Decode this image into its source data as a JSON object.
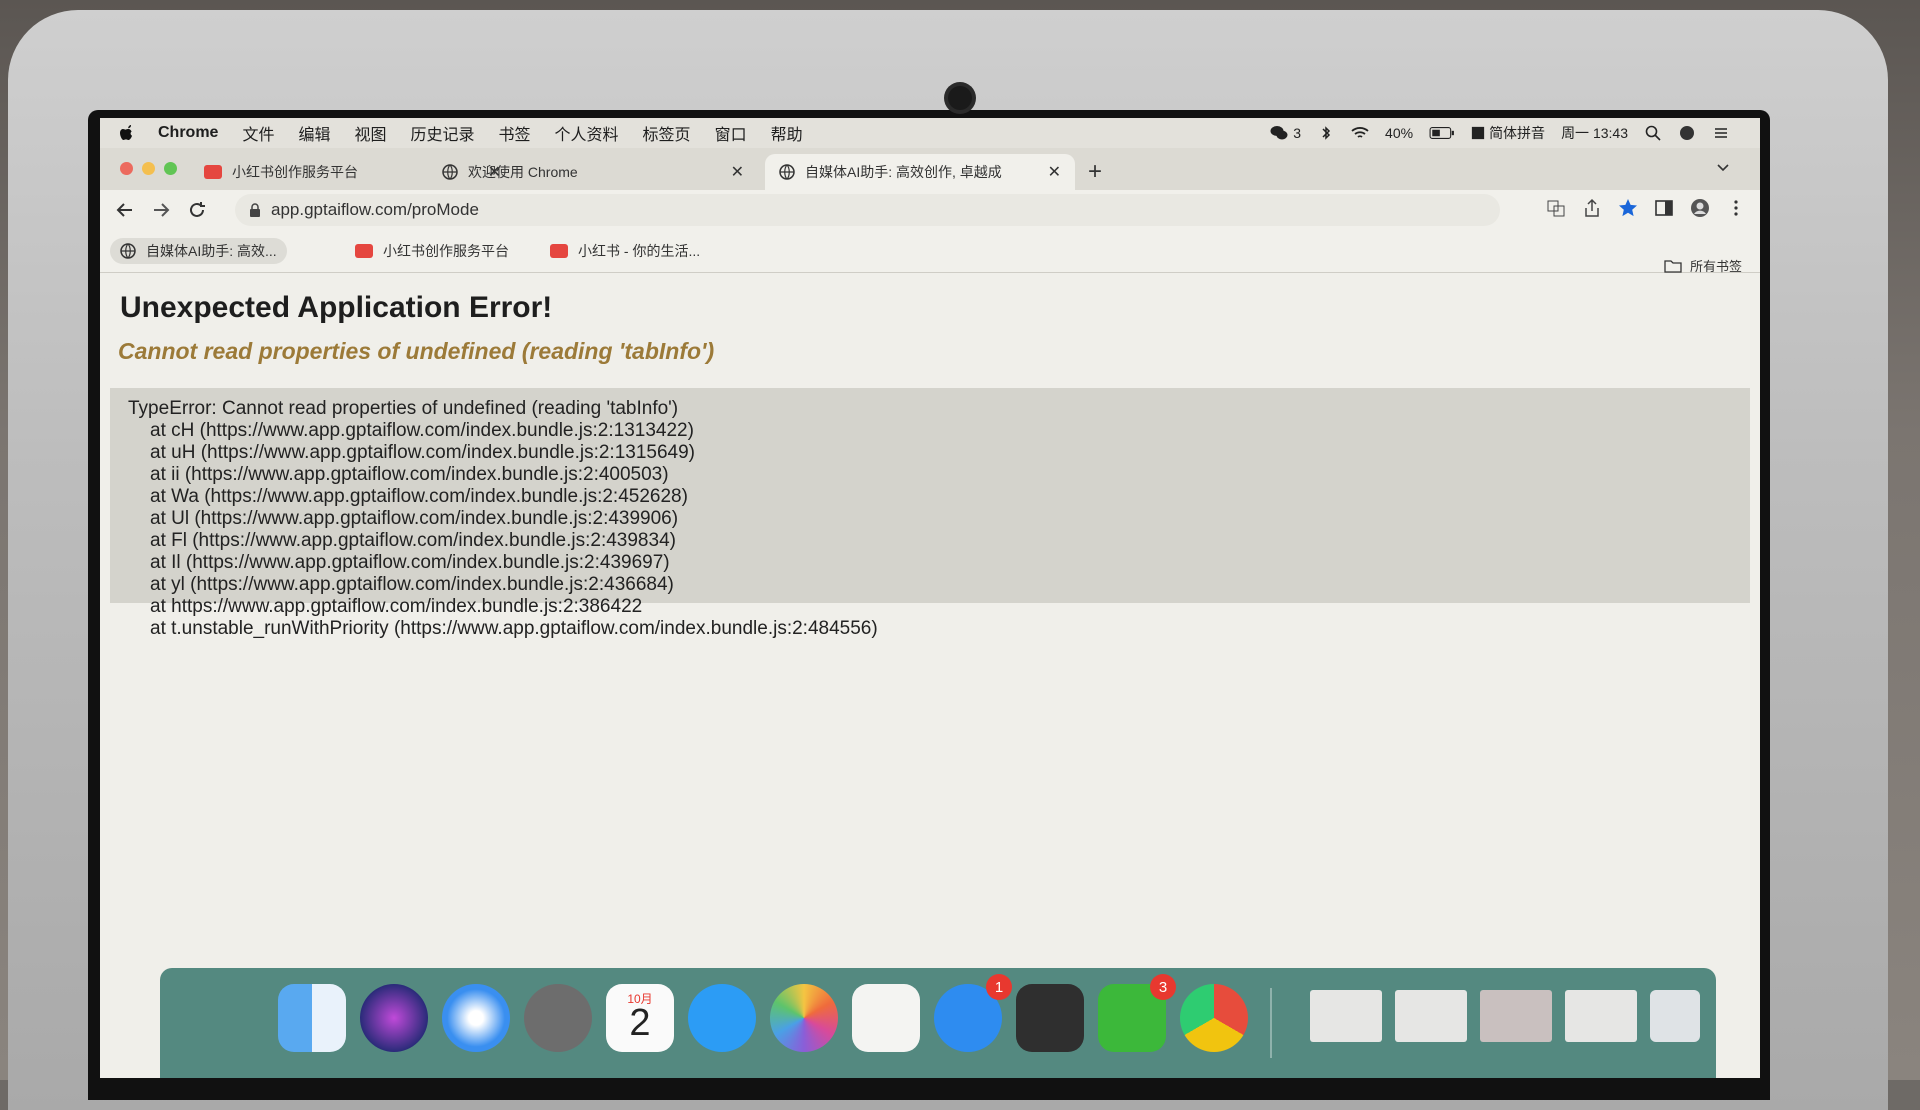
{
  "menubar": {
    "app_name": "Chrome",
    "items": [
      "文件",
      "编辑",
      "视图",
      "历史记录",
      "书签",
      "个人资料",
      "标签页",
      "窗口",
      "帮助"
    ],
    "status": {
      "wechat_count": "3",
      "battery": "40%",
      "input_method": "简体拼音",
      "clock": "周一 13:43"
    }
  },
  "tabs": [
    {
      "title": "小红书创作服务平台"
    },
    {
      "title": "欢迎使用 Chrome"
    },
    {
      "title": "自媒体AI助手: 高效创作, 卓越成"
    }
  ],
  "address": {
    "url": "app.gptaiflow.com/proMode"
  },
  "bookmarks": {
    "items": [
      "自媒体AI助手: 高效...",
      "小红书创作服务平台",
      "小红书 - 你的生活..."
    ],
    "all_label": "所有书签"
  },
  "error": {
    "title": "Unexpected Application Error!",
    "subtitle": "Cannot read properties of undefined (reading 'tabInfo')",
    "stack_head": "TypeError: Cannot read properties of undefined (reading 'tabInfo')",
    "stack_frames": [
      "at cH (https://www.app.gptaiflow.com/index.bundle.js:2:1313422)",
      "at uH (https://www.app.gptaiflow.com/index.bundle.js:2:1315649)",
      "at ii (https://www.app.gptaiflow.com/index.bundle.js:2:400503)",
      "at Wa (https://www.app.gptaiflow.com/index.bundle.js:2:452628)",
      "at Ul (https://www.app.gptaiflow.com/index.bundle.js:2:439906)",
      "at Fl (https://www.app.gptaiflow.com/index.bundle.js:2:439834)",
      "at Il (https://www.app.gptaiflow.com/index.bundle.js:2:439697)",
      "at yl (https://www.app.gptaiflow.com/index.bundle.js:2:436684)",
      "at https://www.app.gptaiflow.com/index.bundle.js:2:386422",
      "at t.unstable_runWithPriority (https://www.app.gptaiflow.com/index.bundle.js:2:484556)"
    ]
  },
  "dock": {
    "apps": [
      "finder-icon",
      "siri-icon",
      "safari-icon",
      "launchpad-icon",
      "calendar-icon",
      "messages-icon",
      "photos-icon",
      "numbers-icon",
      "app-store-icon",
      "system-settings-icon",
      "wechat-icon",
      "chrome-icon"
    ],
    "calendar": {
      "month": "10月",
      "day": "2"
    },
    "app_store_badge": "1",
    "wechat_badge": "3"
  },
  "colors": {
    "error_subtitle": "#9c7a38",
    "stack_bg": "#d4d3cc",
    "dock_bg": "#46807a"
  }
}
